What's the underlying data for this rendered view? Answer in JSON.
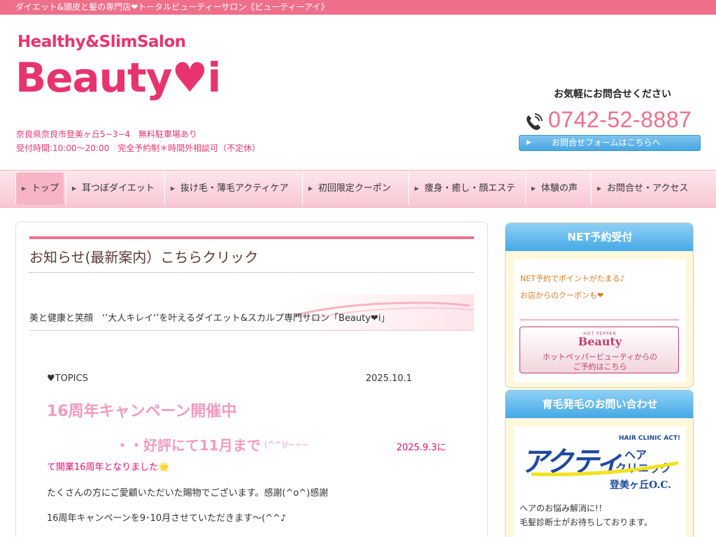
{
  "topbar": {
    "text": "ダイエット&頭皮と髪の専門店❤トータルビューティーサロン《ビューティーアイ》"
  },
  "logo": {
    "subtitle": "Healthy&SlimSalon",
    "title": "Beauty",
    "heart": "♥",
    "suffix": "i"
  },
  "address": {
    "line1": "奈良県奈良市登美ヶ丘5−3−4　無料駐車場あり",
    "line2": "受付時間:10:00〜20:00　完全予約制＊時間外相談可（不定休）"
  },
  "contact": {
    "label": "お気軽にお問合せください",
    "phone": "0742-52-8887",
    "form_arrow": "▶",
    "form_button": "お問合せフォームはこちらへ"
  },
  "nav": {
    "items": [
      {
        "label": "トップ"
      },
      {
        "label": "耳つぼダイエット"
      },
      {
        "label": "抜け毛・薄毛アクティケア"
      },
      {
        "label": "初回限定クーポン"
      },
      {
        "label": "痩身・癒し・顔エステ"
      },
      {
        "label": "体験の声"
      },
      {
        "label": "お問合せ・アクセス"
      }
    ],
    "arrow": "▶"
  },
  "main": {
    "title": "お知らせ(最新案内）こちらクリック",
    "ribbon_text": "美と健康と笑顔　‘’大人キレイ‘’を叶えるダイエット&スカルプ専門サロン「Beauty❤i」",
    "topics_label": "♥TOPICS",
    "topics_date": "2025.10.1",
    "campaign_title": "16周年キャンペーン開催中",
    "campaign_sub": "・・好評にて11月まで",
    "campaign_face": "(^^)/~~~",
    "campaign_date": "2025.9.3に",
    "campaign_line": "て開業16周年となりました🌟",
    "para1": "たくさんの方にご愛顧いただいた賜物でございます。感謝(^o^)感謝",
    "para2": "16周年キャンペーンを9･10月させていただきます〜(^^♪"
  },
  "sidebar": {
    "net": {
      "heading": "NET予約受付",
      "line1": "NET予約でポイントがたまる♪",
      "line2": "お店からのクーポンも❤",
      "hpb_hot": "HOT PEPPER",
      "hpb_brand": "Beauty",
      "hpb_line1": "ホットペッパービューティからの",
      "hpb_line2": "ご予約はこちら"
    },
    "hair": {
      "heading": "育毛発毛のお問い合わせ",
      "logo_top": "HAIR CLINIC ACT!",
      "logo_main": "アクティ",
      "logo_hair": "ヘア",
      "logo_clinic": "クリニック",
      "logo_loc": "登美ヶ丘O.C.",
      "line1": "ヘアのお悩み解消に!！",
      "line2": "毛髪診断士がお待ちしております。"
    }
  },
  "colors": {
    "pink": "#ef6f8a",
    "magenta": "#e8346e",
    "blue": "#45a9e6",
    "light_pink": "#f49ac1"
  }
}
